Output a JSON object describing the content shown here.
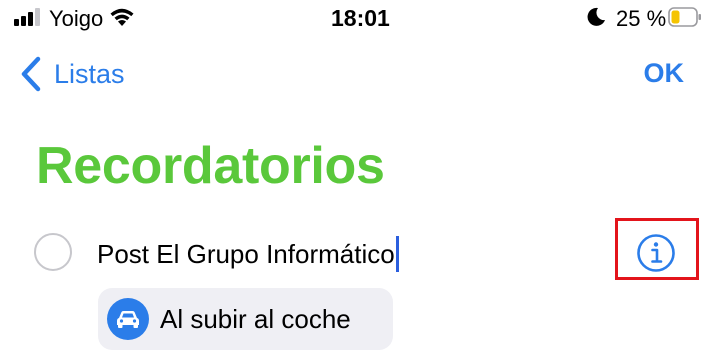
{
  "status_bar": {
    "carrier": "Yoigo",
    "time": "18:01",
    "battery": "25 %",
    "signal_icon": "signal-bars-icon",
    "wifi_icon": "wifi-icon",
    "focus_icon": "moon-icon",
    "battery_icon": "battery-icon",
    "battery_color": "#f5c400"
  },
  "nav": {
    "back_label": "Listas",
    "done_label": "OK",
    "accent": "#2b7de9"
  },
  "list": {
    "title": "Recordatorios",
    "title_color": "#5ac83b"
  },
  "reminder": {
    "text": "Post El Grupo Informático",
    "info_icon": "info-icon",
    "highlight_color": "#e3141b"
  },
  "location": {
    "label": "Al subir al coche",
    "icon": "car-icon"
  }
}
